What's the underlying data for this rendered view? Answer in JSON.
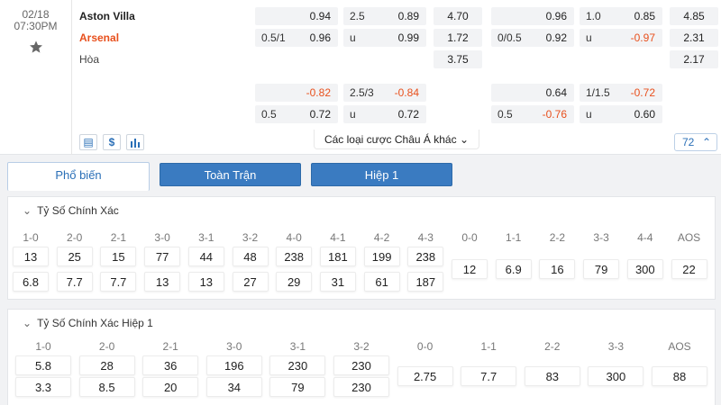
{
  "match": {
    "date": "02/18",
    "time": "07:30PM",
    "home": "Aston Villa",
    "away": "Arsenal",
    "draw": "Hòa"
  },
  "odds": {
    "a": {
      "r0": "0.94",
      "r1_l": "0.5/1",
      "r1": "0.96"
    },
    "b": {
      "r0_l": "2.5",
      "r0": "0.89",
      "r1_l": "u",
      "r1": "0.99"
    },
    "c": {
      "r0": "4.70",
      "r1": "1.72",
      "r2": "3.75"
    },
    "d": {
      "r0": "0.96",
      "r1_l": "0/0.5",
      "r1": "0.92"
    },
    "e": {
      "r0_l": "1.0",
      "r0": "0.85",
      "r1_l": "u",
      "r1": "-0.97"
    },
    "f": {
      "r0": "4.85",
      "r1": "2.31",
      "r2": "2.17"
    },
    "g": {
      "r0": "-0.82",
      "r1_l": "0.5",
      "r1": "0.72"
    },
    "h": {
      "r0_l": "2.5/3",
      "r0": "-0.84",
      "r1_l": "u",
      "r1": "0.72"
    },
    "i": {
      "r0": "0.64",
      "r1_l": "0.5",
      "r1": "-0.76"
    },
    "j": {
      "r0_l": "1/1.5",
      "r0": "-0.72",
      "r1_l": "u",
      "r1": "0.60"
    }
  },
  "more_bets": "Các loại cược Châu Á khác",
  "count": "72",
  "tabs": [
    "Phổ biến",
    "Toàn Trận",
    "Hiệp 1"
  ],
  "panel1": {
    "title": "Tỷ Số Chính Xác",
    "headers": [
      "1-0",
      "2-0",
      "2-1",
      "3-0",
      "3-1",
      "3-2",
      "4-0",
      "4-1",
      "4-2",
      "4-3",
      "0-0",
      "1-1",
      "2-2",
      "3-3",
      "4-4",
      "AOS"
    ],
    "row1": [
      "13",
      "25",
      "15",
      "77",
      "44",
      "48",
      "238",
      "181",
      "199",
      "238"
    ],
    "row2": [
      "6.8",
      "7.7",
      "7.7",
      "13",
      "13",
      "27",
      "29",
      "31",
      "61",
      "187"
    ],
    "single": [
      "12",
      "6.9",
      "16",
      "79",
      "300",
      "22"
    ]
  },
  "panel2": {
    "title": "Tỷ Số Chính Xác Hiệp 1",
    "headers": [
      "1-0",
      "2-0",
      "2-1",
      "3-0",
      "3-1",
      "3-2",
      "0-0",
      "1-1",
      "2-2",
      "3-3",
      "AOS"
    ],
    "row1": [
      "5.8",
      "28",
      "36",
      "196",
      "230",
      "230"
    ],
    "row2": [
      "3.3",
      "8.5",
      "20",
      "34",
      "79",
      "230"
    ],
    "single": [
      "2.75",
      "7.7",
      "83",
      "300",
      "88"
    ]
  }
}
